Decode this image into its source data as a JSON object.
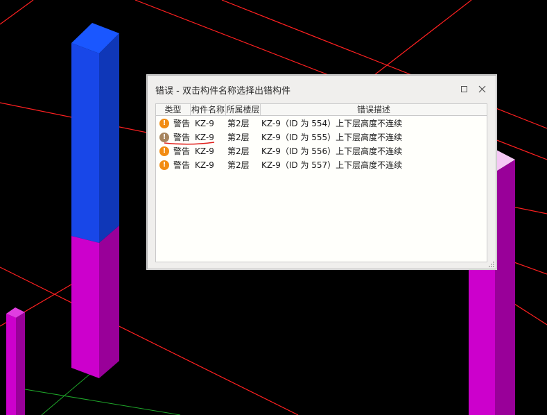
{
  "dialog": {
    "title": "错误 - 双击构件名称选择出错构件",
    "columns": {
      "type": "类型",
      "name": "构件名称",
      "floor": "所属楼层",
      "description": "错误描述"
    },
    "rows": [
      {
        "type": "警告",
        "name": "KZ-9",
        "floor": "第2层",
        "description": "KZ-9（ID 为 554）上下层高度不连续"
      },
      {
        "type": "警告",
        "name": "KZ-9",
        "floor": "第2层",
        "description": "KZ-9（ID 为 555）上下层高度不连续"
      },
      {
        "type": "警告",
        "name": "KZ-9",
        "floor": "第2层",
        "description": "KZ-9（ID 为 556）上下层高度不连续"
      },
      {
        "type": "警告",
        "name": "KZ-9",
        "floor": "第2层",
        "description": "KZ-9（ID 为 557）上下层高度不连续"
      }
    ],
    "warning_icon": "exclamation-circle-icon",
    "colors": {
      "warning_icon": "#f28c13",
      "warning_icon_selected": "#a7855f",
      "annotation_underline": "#e0201b"
    }
  },
  "scene": {
    "colors": {
      "background": "#000000",
      "grid_line_red": "#ff2020",
      "grid_line_green": "#1fa82a",
      "column_blue": "#1a4de0",
      "column_magenta": "#cc00cc"
    }
  }
}
